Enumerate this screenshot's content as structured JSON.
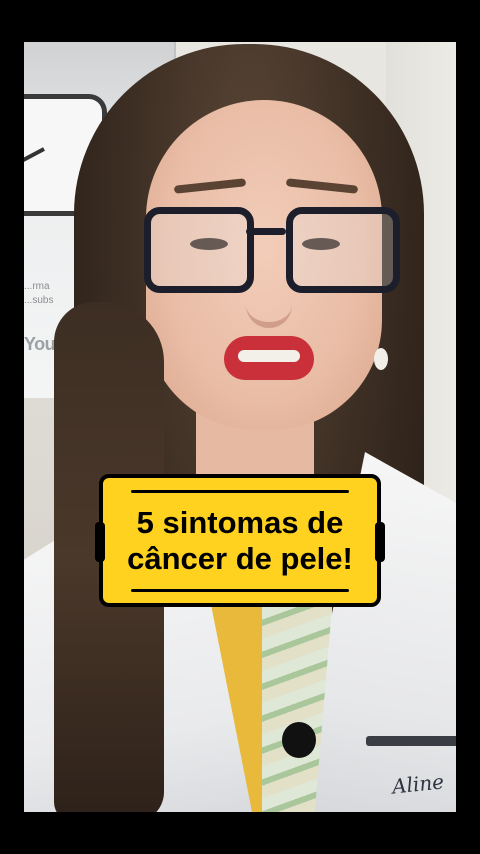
{
  "background": {
    "plaque": {
      "text_lines": [
        "...rma",
        "...subs"
      ],
      "logo_text": "YouTub"
    }
  },
  "coat": {
    "embroidery_text": "Aline"
  },
  "caption": {
    "line1": "5 sintomas de",
    "line2": "câncer de pele!",
    "background_color": "#ffd21f",
    "text_color": "#000000"
  }
}
